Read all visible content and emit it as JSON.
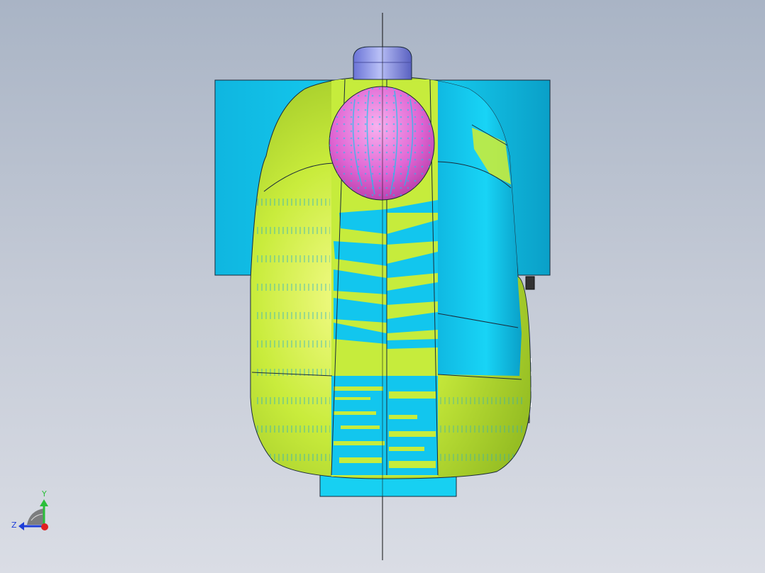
{
  "viewport": {
    "background_top": "#a9b4c5",
    "background_bottom": "#dadde5"
  },
  "model": {
    "body_color": "#c6ec3c",
    "cyan_color": "#12c6ee",
    "sphere_color": "#e66ad6",
    "cap_color": "#7f88e6",
    "outline_color": "#1a2a3a"
  },
  "triad": {
    "y_label": "Y",
    "z_label": "Z",
    "y_color": "#2bbf3a",
    "z_color": "#1f3fd8",
    "x_color": "#e02020"
  }
}
